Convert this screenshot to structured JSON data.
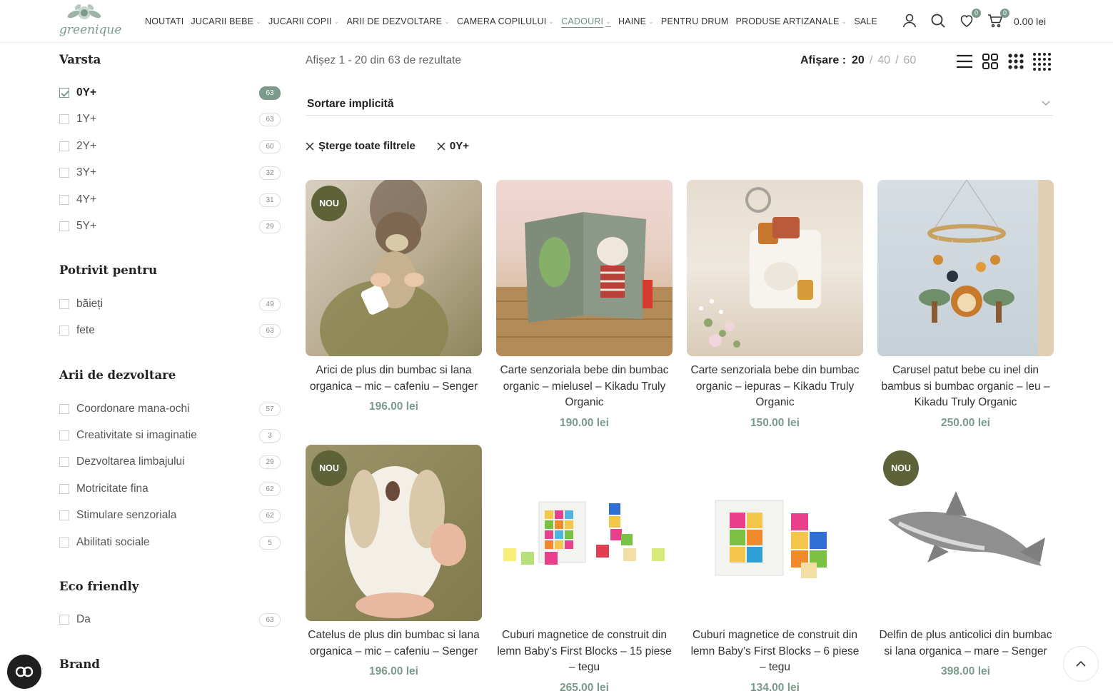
{
  "header": {
    "logo_text": "greenique",
    "nav": [
      {
        "label": "NOUTATI",
        "dropdown": false
      },
      {
        "label": "JUCARII BEBE",
        "dropdown": true
      },
      {
        "label": "JUCARII COPII",
        "dropdown": true
      },
      {
        "label": "ARII DE DEZVOLTARE",
        "dropdown": true
      },
      {
        "label": "CAMERA COPILULUI",
        "dropdown": true
      },
      {
        "label": "CADOURI",
        "dropdown": true,
        "active": true
      },
      {
        "label": "HAINE",
        "dropdown": true
      },
      {
        "label": "PENTRU DRUM",
        "dropdown": false
      },
      {
        "label": "PRODUSE ARTIZANALE",
        "dropdown": true
      },
      {
        "label": "SALE",
        "dropdown": false
      }
    ],
    "wishlist_count": "0",
    "cart_count": "0",
    "cart_total": "0.00 lei",
    "accent_color": "#7a9b8c"
  },
  "sidebar": {
    "varsta": {
      "title": "Varsta",
      "items": [
        {
          "label": "0Y+",
          "count": "63",
          "checked": true
        },
        {
          "label": "1Y+",
          "count": "63"
        },
        {
          "label": "2Y+",
          "count": "60"
        },
        {
          "label": "3Y+",
          "count": "32"
        },
        {
          "label": "4Y+",
          "count": "31"
        },
        {
          "label": "5Y+",
          "count": "29"
        }
      ]
    },
    "potrivit": {
      "title": "Potrivit pentru",
      "items": [
        {
          "label": "băieți",
          "count": "49"
        },
        {
          "label": "fete",
          "count": "63"
        }
      ]
    },
    "arii": {
      "title": "Arii de dezvoltare",
      "items": [
        {
          "label": "Coordonare mana-ochi",
          "count": "57"
        },
        {
          "label": "Creativitate si imaginatie",
          "count": "3"
        },
        {
          "label": "Dezvoltarea limbajului",
          "count": "29"
        },
        {
          "label": "Motricitate fina",
          "count": "62"
        },
        {
          "label": "Stimulare senzoriala",
          "count": "62"
        },
        {
          "label": "Abilitati sociale",
          "count": "5"
        }
      ]
    },
    "eco": {
      "title": "Eco friendly",
      "items": [
        {
          "label": "Da",
          "count": "63"
        }
      ]
    },
    "brand": {
      "title": "Brand"
    }
  },
  "toolbar": {
    "result_count": "Afișez 1 - 20 din 63 de rezultate",
    "perpage_label": "Afișare :",
    "perpage_options": [
      "20",
      "40",
      "60"
    ],
    "perpage_selected": "20",
    "sort_label": "Sortare implicită",
    "clear_filters": "Șterge toate filtrele",
    "active_filter": "0Y+"
  },
  "products": [
    {
      "title": "Arici de plus din bumbac si lana organica – mic – cafeniu – Senger",
      "price": "196.00 lei",
      "badge": "NOU"
    },
    {
      "title": "Carte senzoriala bebe din bumbac organic – mielusel – Kikadu Truly Organic",
      "price": "190.00 lei",
      "badge": ""
    },
    {
      "title": "Carte senzoriala bebe din bumbac organic – iepuras – Kikadu Truly Organic",
      "price": "150.00 lei",
      "badge": ""
    },
    {
      "title": "Carusel patut bebe cu inel din bambus si bumbac organic – leu – Kikadu Truly Organic",
      "price": "250.00 lei",
      "badge": ""
    },
    {
      "title": "Catelus de plus din bumbac si lana organica – mic – cafeniu – Senger",
      "price": "196.00 lei",
      "badge": "NOU"
    },
    {
      "title": "Cuburi magnetice de construit din lemn Baby’s First Blocks – 15 piese – tegu",
      "price": "265.00 lei",
      "badge": ""
    },
    {
      "title": "Cuburi magnetice de construit din lemn Baby’s First Blocks – 6 piese – tegu",
      "price": "134.00 lei",
      "badge": ""
    },
    {
      "title": "Delfin de plus anticolici din bumbac si lana organica – mare – Senger",
      "price": "398.00 lei",
      "badge": "NOU"
    }
  ]
}
